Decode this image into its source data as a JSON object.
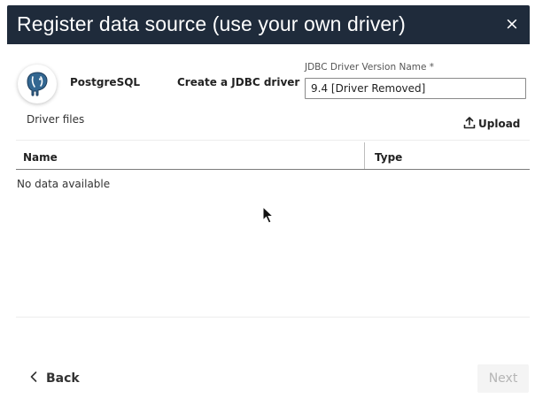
{
  "dialog": {
    "title": "Register data source (use your own driver)",
    "close_symbol": "×"
  },
  "source": {
    "name": "PostgreSQL",
    "logo_icon": "postgresql-elephant-icon"
  },
  "driver": {
    "heading": "Create a JDBC driver",
    "version_label": "JDBC Driver Version Name *",
    "version_value": "9.4 [Driver Removed]"
  },
  "files": {
    "label": "Driver files",
    "upload_label": "Upload",
    "upload_icon": "upload-icon"
  },
  "table": {
    "columns": [
      "Name",
      "Type"
    ],
    "empty_message": "No data available"
  },
  "footer": {
    "back_label": "Back",
    "next_label": "Next"
  },
  "colors": {
    "title_bar": "#1f2b3b",
    "next_disabled_bg": "#f4f4f4",
    "next_disabled_text": "#b5b5b5"
  }
}
